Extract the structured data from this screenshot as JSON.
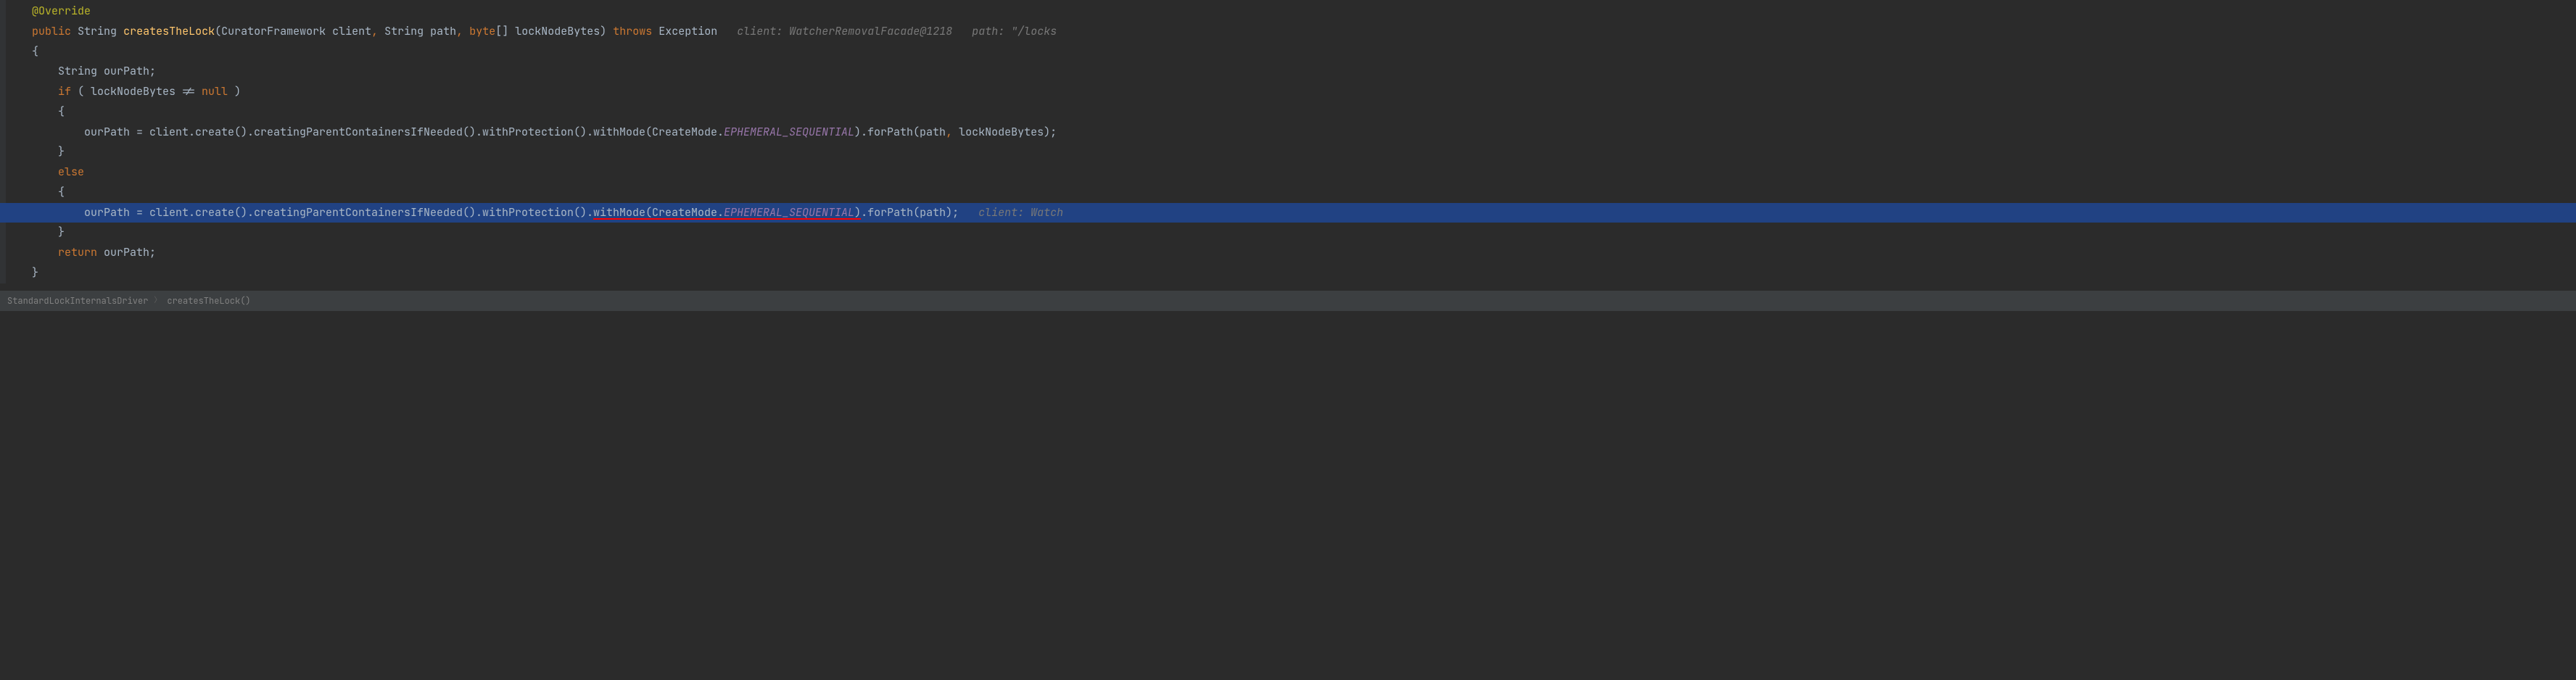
{
  "code": {
    "line1": {
      "annotation": "@Override"
    },
    "line2": {
      "kw_public": "public",
      "type_string": "String",
      "method": "createsTheLock",
      "paren_open": "(",
      "type_cf": "CuratorFramework",
      "param_client": " client",
      "comma1": ",",
      "type_string2": " String",
      "param_path": " path",
      "comma2": ",",
      "kw_byte": " byte",
      "brackets": "[]",
      "param_lnb": " lockNodeBytes",
      "paren_close": ")",
      "kw_throws": " throws",
      "type_exc": " Exception",
      "hint_client": "   client: WatcherRemovalFacade@1218",
      "hint_path": "   path: \"/locks"
    },
    "line3": {
      "brace": "{"
    },
    "line4": {
      "type_string": "String",
      "var": " ourPath;"
    },
    "line5": {
      "kw_if": "if",
      "cond": " ( lockNodeBytes != ",
      "kw_null": "null",
      "close": " )"
    },
    "line6": {
      "brace": "{"
    },
    "line7": {
      "pre": "ourPath = client.create().creatingParentContainersIfNeeded().withProtection().withMode(CreateMode.",
      "const": "EPHEMERAL_SEQUENTIAL",
      "post": ").forPath(path",
      "comma": ",",
      "post2": " lockNodeBytes);"
    },
    "line8": {
      "brace": "}"
    },
    "line9": {
      "kw_else": "else"
    },
    "line10": {
      "brace": "{"
    },
    "line11": {
      "pre": "ourPath = client.create().creatingParentContainersIfNeeded().withProtection().",
      "withmode": "withMode(CreateMode.",
      "const": "EPHEMERAL_SEQUENTIAL",
      "closep": ")",
      "post": ".forPath(path);",
      "hint": "   client: Watch"
    },
    "line12": {
      "brace": "}"
    },
    "line13": {
      "kw_return": "return",
      "var": " ourPath;"
    },
    "line14": {
      "brace": "}"
    }
  },
  "breadcrumbs": {
    "item1": "StandardLockInternalsDriver",
    "item2": "createsTheLock()"
  }
}
